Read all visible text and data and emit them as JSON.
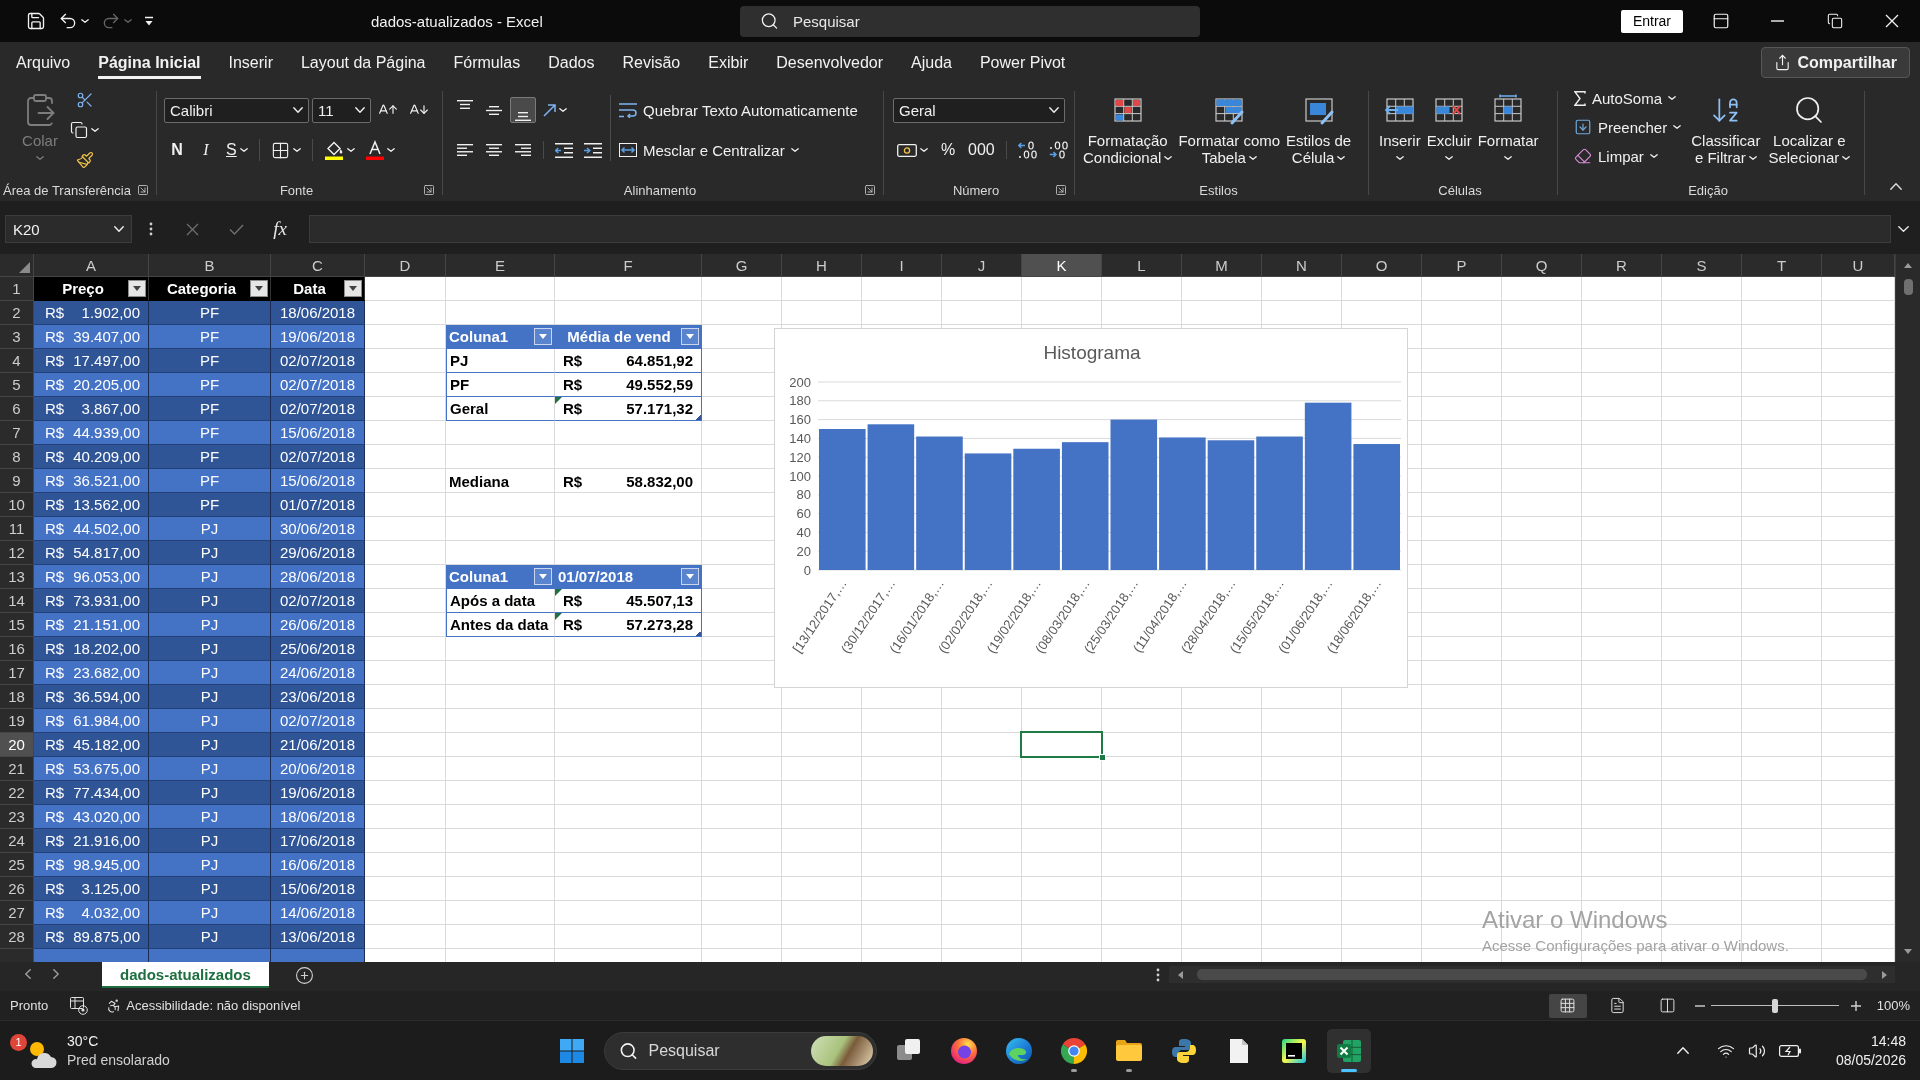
{
  "title_bar": {
    "title": "dados-atualizados - Excel",
    "search_placeholder": "Pesquisar",
    "sign_in": "Entrar",
    "redo_disabled": true
  },
  "ribbon_tabs": [
    {
      "label": "Arquivo",
      "selected": false
    },
    {
      "label": "Página Inicial",
      "selected": true
    },
    {
      "label": "Inserir",
      "selected": false
    },
    {
      "label": "Layout da Página",
      "selected": false
    },
    {
      "label": "Fórmulas",
      "selected": false
    },
    {
      "label": "Dados",
      "selected": false
    },
    {
      "label": "Revisão",
      "selected": false
    },
    {
      "label": "Exibir",
      "selected": false
    },
    {
      "label": "Desenvolvedor",
      "selected": false
    },
    {
      "label": "Ajuda",
      "selected": false
    },
    {
      "label": "Power Pivot",
      "selected": false
    }
  ],
  "share_button": "Compartilhar",
  "ribbon": {
    "clipboard": {
      "label": "Área de Transferência",
      "paste": "Colar",
      "paste_disabled": true
    },
    "font": {
      "label": "Fonte",
      "font_name": "Calibri",
      "font_size": "11",
      "bold": "N",
      "italic": "I",
      "underline": "S"
    },
    "alignment": {
      "label": "Alinhamento",
      "vertical": [
        {
          "kind": "top",
          "selected": false
        },
        {
          "kind": "middle",
          "selected": false
        },
        {
          "kind": "bottom",
          "selected": true
        }
      ],
      "wrap_text": "Quebrar Texto Automaticamente",
      "merge": "Mesclar e Centralizar"
    },
    "number": {
      "label": "Número",
      "format": "Geral",
      "percent": "%",
      "thousands": "000"
    },
    "styles": {
      "label": "Estilos",
      "buttons": [
        {
          "kind": "conditional",
          "lines": [
            "Formatação",
            "Condicional"
          ]
        },
        {
          "kind": "table",
          "lines": [
            "Formatar como",
            "Tabela"
          ]
        },
        {
          "kind": "cell",
          "lines": [
            "Estilos de",
            "Célula"
          ]
        }
      ]
    },
    "cells": {
      "label": "Células",
      "buttons": [
        {
          "kind": "insert",
          "label": "Inserir"
        },
        {
          "kind": "delete",
          "label": "Excluir"
        },
        {
          "kind": "format",
          "label": "Formatar"
        }
      ]
    },
    "editing": {
      "label": "Edição",
      "small": [
        {
          "kind": "sum",
          "label": "AutoSoma"
        },
        {
          "kind": "fill",
          "label": "Preencher"
        },
        {
          "kind": "clear",
          "label": "Limpar"
        }
      ],
      "large": [
        {
          "kind": "sort",
          "lines": [
            "Classificar",
            "e Filtrar"
          ]
        },
        {
          "kind": "find",
          "lines": [
            "Localizar e",
            "Selecionar"
          ]
        }
      ]
    }
  },
  "formula_bar": {
    "name_box": "K20",
    "function_button": "fx",
    "editing": false
  },
  "sheet": {
    "columns": [
      {
        "label": "A",
        "selected": false
      },
      {
        "label": "B",
        "selected": false
      },
      {
        "label": "C",
        "selected": false
      },
      {
        "label": "D",
        "selected": false
      },
      {
        "label": "E",
        "selected": false
      },
      {
        "label": "F",
        "selected": false
      },
      {
        "label": "G",
        "selected": false
      },
      {
        "label": "H",
        "selected": false
      },
      {
        "label": "I",
        "selected": false
      },
      {
        "label": "J",
        "selected": false
      },
      {
        "label": "K",
        "selected": true
      },
      {
        "label": "L",
        "selected": false
      },
      {
        "label": "M",
        "selected": false
      },
      {
        "label": "N",
        "selected": false
      },
      {
        "label": "O",
        "selected": false
      },
      {
        "label": "P",
        "selected": false
      },
      {
        "label": "Q",
        "selected": false
      },
      {
        "label": "R",
        "selected": false
      },
      {
        "label": "S",
        "selected": false
      },
      {
        "label": "T",
        "selected": false
      },
      {
        "label": "U",
        "selected": false
      }
    ],
    "rows": [
      {
        "label": "1",
        "selected": false
      },
      {
        "label": "2",
        "selected": false
      },
      {
        "label": "3",
        "selected": false
      },
      {
        "label": "4",
        "selected": false
      },
      {
        "label": "5",
        "selected": false
      },
      {
        "label": "6",
        "selected": false
      },
      {
        "label": "7",
        "selected": false
      },
      {
        "label": "8",
        "selected": false
      },
      {
        "label": "9",
        "selected": false
      },
      {
        "label": "10",
        "selected": false
      },
      {
        "label": "11",
        "selected": false
      },
      {
        "label": "12",
        "selected": false
      },
      {
        "label": "13",
        "selected": false
      },
      {
        "label": "14",
        "selected": false
      },
      {
        "label": "15",
        "selected": false
      },
      {
        "label": "16",
        "selected": false
      },
      {
        "label": "17",
        "selected": false
      },
      {
        "label": "18",
        "selected": false
      },
      {
        "label": "19",
        "selected": false
      },
      {
        "label": "20",
        "selected": true
      },
      {
        "label": "21",
        "selected": false
      },
      {
        "label": "22",
        "selected": false
      },
      {
        "label": "23",
        "selected": false
      },
      {
        "label": "24",
        "selected": false
      },
      {
        "label": "25",
        "selected": false
      },
      {
        "label": "26",
        "selected": false
      },
      {
        "label": "27",
        "selected": false
      },
      {
        "label": "28",
        "selected": false
      }
    ],
    "partial_row_below": true
  },
  "data_table": {
    "headers": [
      "Preço",
      "Categoria",
      "Data"
    ],
    "rows": [
      {
        "currency": "R$",
        "amount": "1.902,00",
        "category": "PF",
        "date": "18/06/2018"
      },
      {
        "currency": "R$",
        "amount": "39.407,00",
        "category": "PF",
        "date": "19/06/2018"
      },
      {
        "currency": "R$",
        "amount": "17.497,00",
        "category": "PF",
        "date": "02/07/2018"
      },
      {
        "currency": "R$",
        "amount": "20.205,00",
        "category": "PF",
        "date": "02/07/2018"
      },
      {
        "currency": "R$",
        "amount": "3.867,00",
        "category": "PF",
        "date": "02/07/2018"
      },
      {
        "currency": "R$",
        "amount": "44.939,00",
        "category": "PF",
        "date": "15/06/2018"
      },
      {
        "currency": "R$",
        "amount": "40.209,00",
        "category": "PF",
        "date": "02/07/2018"
      },
      {
        "currency": "R$",
        "amount": "36.521,00",
        "category": "PF",
        "date": "15/06/2018"
      },
      {
        "currency": "R$",
        "amount": "13.562,00",
        "category": "PF",
        "date": "01/07/2018"
      },
      {
        "currency": "R$",
        "amount": "44.502,00",
        "category": "PJ",
        "date": "30/06/2018"
      },
      {
        "currency": "R$",
        "amount": "54.817,00",
        "category": "PJ",
        "date": "29/06/2018"
      },
      {
        "currency": "R$",
        "amount": "96.053,00",
        "category": "PJ",
        "date": "28/06/2018"
      },
      {
        "currency": "R$",
        "amount": "73.931,00",
        "category": "PJ",
        "date": "02/07/2018"
      },
      {
        "currency": "R$",
        "amount": "21.151,00",
        "category": "PJ",
        "date": "26/06/2018"
      },
      {
        "currency": "R$",
        "amount": "18.202,00",
        "category": "PJ",
        "date": "25/06/2018"
      },
      {
        "currency": "R$",
        "amount": "23.682,00",
        "category": "PJ",
        "date": "24/06/2018"
      },
      {
        "currency": "R$",
        "amount": "36.594,00",
        "category": "PJ",
        "date": "23/06/2018"
      },
      {
        "currency": "R$",
        "amount": "61.984,00",
        "category": "PJ",
        "date": "02/07/2018"
      },
      {
        "currency": "R$",
        "amount": "45.182,00",
        "category": "PJ",
        "date": "21/06/2018"
      },
      {
        "currency": "R$",
        "amount": "53.675,00",
        "category": "PJ",
        "date": "20/06/2018"
      },
      {
        "currency": "R$",
        "amount": "77.434,00",
        "category": "PJ",
        "date": "19/06/2018"
      },
      {
        "currency": "R$",
        "amount": "43.020,00",
        "category": "PJ",
        "date": "18/06/2018"
      },
      {
        "currency": "R$",
        "amount": "21.916,00",
        "category": "PJ",
        "date": "17/06/2018"
      },
      {
        "currency": "R$",
        "amount": "98.945,00",
        "category": "PJ",
        "date": "16/06/2018"
      },
      {
        "currency": "R$",
        "amount": "3.125,00",
        "category": "PJ",
        "date": "15/06/2018"
      },
      {
        "currency": "R$",
        "amount": "4.032,00",
        "category": "PJ",
        "date": "14/06/2018"
      },
      {
        "currency": "R$",
        "amount": "89.875,00",
        "category": "PJ",
        "date": "13/06/2018"
      }
    ]
  },
  "average_table": {
    "headers": [
      "Coluna1",
      "Média de vend"
    ],
    "rows": [
      {
        "label": "PJ",
        "currency": "R$",
        "amount": "64.851,92",
        "flagged": false
      },
      {
        "label": "PF",
        "currency": "R$",
        "amount": "49.552,59",
        "flagged": false
      },
      {
        "label": "Geral",
        "currency": "R$",
        "amount": "57.171,32",
        "flagged": true
      }
    ]
  },
  "median": {
    "label": "Mediana",
    "currency": "R$",
    "amount": "58.832,00"
  },
  "date_table": {
    "headers": [
      "Coluna1",
      "01/07/2018"
    ],
    "rows": [
      {
        "label": "Após a data",
        "currency": "R$",
        "amount": "45.507,13",
        "flagged": true
      },
      {
        "label": "Antes da data",
        "currency": "R$",
        "amount": "57.273,28",
        "flagged": true
      }
    ]
  },
  "chart": {
    "chart_data": {
      "type": "bar",
      "title": "Histograma",
      "categories": [
        "[13/12/2017,…",
        "(30/12/2017,…",
        "(16/01/2018,…",
        "(02/02/2018,…",
        "(19/02/2018,…",
        "(08/03/2018,…",
        "(25/03/2018,…",
        "(11/04/2018,…",
        "(28/04/2018,…",
        "(15/05/2018,…",
        "(01/06/2018,…",
        "(18/06/2018,…"
      ],
      "values": [
        150,
        155,
        142,
        124,
        129,
        136,
        160,
        141,
        138,
        142,
        178,
        134
      ],
      "ylim": [
        0,
        200
      ],
      "yticks": [
        0,
        20,
        40,
        60,
        80,
        100,
        120,
        140,
        160,
        180,
        200
      ],
      "grid": true
    }
  },
  "activation_notice": {
    "title": "Ativar o Windows",
    "text": "Acesse Configurações para ativar o Windows."
  },
  "sheet_tabs": [
    {
      "label": "dados-atualizados",
      "selected": true
    }
  ],
  "status_bar": {
    "status": "Pronto",
    "accessibility": "Acessibilidade: não disponível",
    "views": [
      {
        "kind": "normal",
        "selected": true
      },
      {
        "kind": "page_layout",
        "selected": false
      },
      {
        "kind": "page_break",
        "selected": false
      }
    ],
    "zoom": {
      "level": 0.5,
      "reading": "100%"
    }
  },
  "taskbar": {
    "weather": {
      "badge": "1",
      "temperature": "30°C",
      "condition": "Pred ensolarado"
    },
    "search_placeholder": "Pesquisar",
    "apps": [
      {
        "kind": "task_view",
        "running": false,
        "active": false
      },
      {
        "kind": "firefox",
        "running": false,
        "active": false
      },
      {
        "kind": "edge",
        "running": false,
        "active": false
      },
      {
        "kind": "chrome",
        "running": true,
        "active": false
      },
      {
        "kind": "files",
        "running": true,
        "active": false
      },
      {
        "kind": "python",
        "running": false,
        "active": false
      },
      {
        "kind": "document",
        "running": false,
        "active": false
      },
      {
        "kind": "pycharm",
        "running": false,
        "active": false
      },
      {
        "kind": "excel",
        "running": true,
        "active": true
      }
    ],
    "time": "14:48",
    "date": "08/05/2026"
  }
}
